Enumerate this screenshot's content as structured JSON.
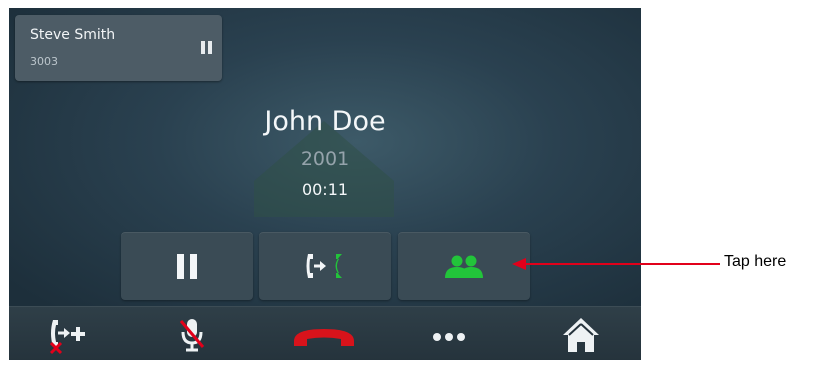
{
  "held_call": {
    "name": "Steve Smith",
    "number": "3003",
    "icon": "pause-icon"
  },
  "active_call": {
    "name": "John Doe",
    "number": "2001",
    "timer": "00:11"
  },
  "controls": [
    {
      "icon": "pause-icon"
    },
    {
      "icon": "transfer-icon"
    },
    {
      "icon": "conference-icon"
    }
  ],
  "bottom_bar": [
    {
      "icon": "add-transfer-icon"
    },
    {
      "icon": "mute-mic-icon"
    },
    {
      "icon": "end-call-icon"
    },
    {
      "icon": "more-icon"
    },
    {
      "icon": "home-icon"
    }
  ],
  "annotation": {
    "text": "Tap here"
  },
  "colors": {
    "accent_green": "#22c43a",
    "end_call_red": "#d8131b",
    "annotation_red": "#e2001a"
  }
}
